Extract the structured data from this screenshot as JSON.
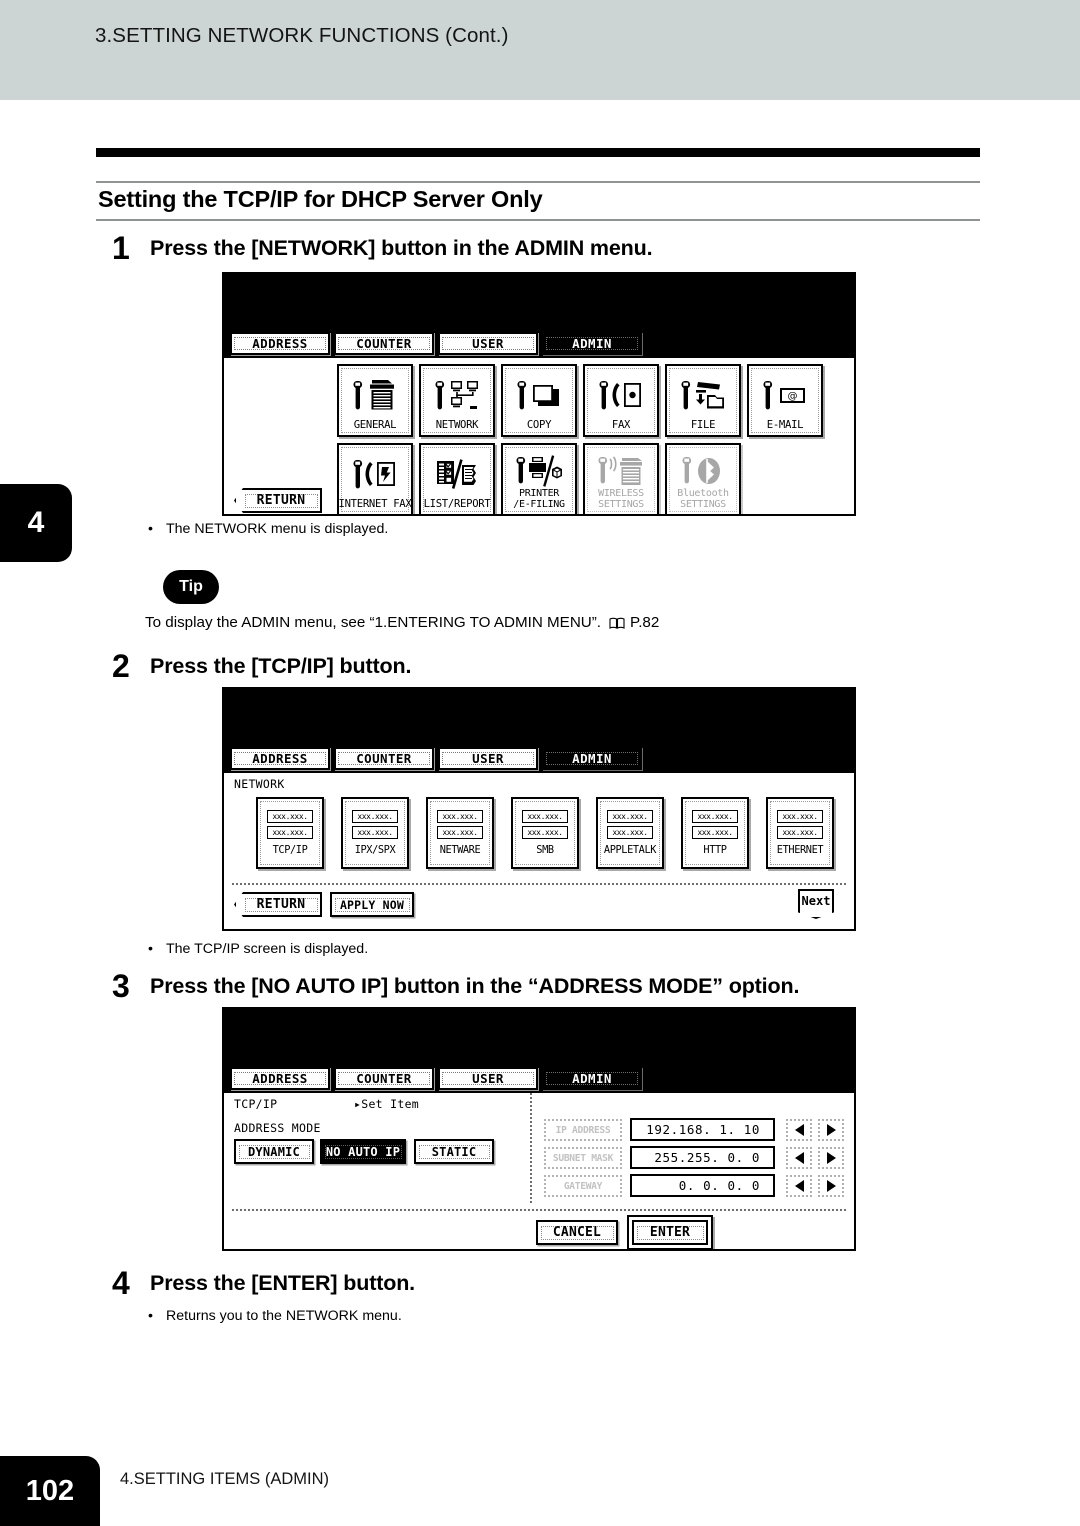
{
  "header": {
    "running_head": "3.SETTING NETWORK FUNCTIONS (Cont.)"
  },
  "chapter_tab": "4",
  "section": {
    "title": "Setting the TCP/IP for DHCP Server Only"
  },
  "steps": [
    {
      "number": "1",
      "text": "Press the [NETWORK] button in the ADMIN menu."
    },
    {
      "number": "2",
      "text": "Press the [TCP/IP] button."
    },
    {
      "number": "3",
      "text": "Press the [NO AUTO IP] button in the “ADDRESS MODE” option."
    },
    {
      "number": "4",
      "text": "Press the [ENTER] button."
    }
  ],
  "notes": {
    "step1": "The NETWORK menu is displayed.",
    "step2": "The TCP/IP screen is displayed.",
    "step4": "Returns you to the NETWORK menu."
  },
  "tip": {
    "badge": "Tip",
    "text_before": "To display the ADMIN menu, see “1.ENTERING TO ADMIN MENU”.",
    "page_ref": "P.82"
  },
  "screens": {
    "admin_menu": {
      "tabs": [
        {
          "label": "ADDRESS",
          "selected": false
        },
        {
          "label": "COUNTER",
          "selected": false
        },
        {
          "label": "USER",
          "selected": false
        },
        {
          "label": "ADMIN",
          "selected": true
        }
      ],
      "tiles_row1": [
        {
          "label": "GENERAL",
          "icon": "wrench-copier-icon",
          "disabled": false
        },
        {
          "label": "NETWORK",
          "icon": "wrench-network-icon",
          "disabled": false
        },
        {
          "label": "COPY",
          "icon": "wrench-copy-icon",
          "disabled": false
        },
        {
          "label": "FAX",
          "icon": "wrench-fax-icon",
          "disabled": false
        },
        {
          "label": "FILE",
          "icon": "wrench-file-icon",
          "disabled": false
        },
        {
          "label": "E-MAIL",
          "icon": "wrench-email-icon",
          "disabled": false
        }
      ],
      "tiles_row2": [
        {
          "label": "INTERNET FAX",
          "label2": "",
          "icon": "wrench-internetfax-icon",
          "disabled": false
        },
        {
          "label": "LIST/REPORT",
          "label2": "",
          "icon": "list-report-icon",
          "disabled": false
        },
        {
          "label": "PRINTER",
          "label2": "/E-FILING",
          "icon": "wrench-printer-icon",
          "disabled": false
        },
        {
          "label": "WIRELESS",
          "label2": "SETTINGS",
          "icon": "wrench-wireless-icon",
          "disabled": true
        },
        {
          "label": "Bluetooth",
          "label2": "SETTINGS",
          "icon": "wrench-bluetooth-icon",
          "disabled": true
        }
      ],
      "return_button": "RETURN"
    },
    "network_menu": {
      "tabs": [
        {
          "label": "ADDRESS",
          "selected": false
        },
        {
          "label": "COUNTER",
          "selected": false
        },
        {
          "label": "USER",
          "selected": false
        },
        {
          "label": "ADMIN",
          "selected": true
        }
      ],
      "caption": "NETWORK",
      "tiles": [
        {
          "label": "TCP/IP",
          "line1": "xxx.xxx.",
          "line2": "xxx.xxx."
        },
        {
          "label": "IPX/SPX",
          "line1": "xxx.xxx.",
          "line2": "xxx.xxx."
        },
        {
          "label": "NETWARE",
          "line1": "xxx.xxx.",
          "line2": "xxx.xxx."
        },
        {
          "label": "SMB",
          "line1": "xxx.xxx.",
          "line2": "xxx.xxx."
        },
        {
          "label": "APPLETALK",
          "line1": "xxx.xxx.",
          "line2": "xxx.xxx."
        },
        {
          "label": "HTTP",
          "line1": "xxx.xxx.",
          "line2": "xxx.xxx."
        },
        {
          "label": "ETHERNET",
          "line1": "xxx.xxx.",
          "line2": "xxx.xxx."
        }
      ],
      "return_button": "RETURN",
      "apply_button": "APPLY NOW",
      "next_button": "Next"
    },
    "tcpip_screen": {
      "tabs": [
        {
          "label": "ADDRESS",
          "selected": false
        },
        {
          "label": "COUNTER",
          "selected": false
        },
        {
          "label": "USER",
          "selected": false
        },
        {
          "label": "ADMIN",
          "selected": true
        }
      ],
      "caption": "TCP/IP",
      "set_item": "Set Item",
      "address_mode_label": "ADDRESS MODE",
      "address_mode_options": [
        {
          "label": "DYNAMIC",
          "selected": false
        },
        {
          "label": "NO AUTO IP",
          "selected": true
        },
        {
          "label": "STATIC",
          "selected": false
        }
      ],
      "fields": [
        {
          "label": "IP ADDRESS",
          "value": "192.168.  1. 10"
        },
        {
          "label": "SUBNET MASK",
          "value": "255.255.  0.  0"
        },
        {
          "label": "GATEWAY",
          "value": "0.  0.  0.  0"
        }
      ],
      "cancel_button": "CANCEL",
      "enter_button": "ENTER"
    }
  },
  "footer": {
    "page_number": "102",
    "chapter": "4.SETTING ITEMS (ADMIN)"
  },
  "colors": {
    "header_band": "#ccd5d3",
    "ink": "#000000",
    "rule": "#8d9492"
  }
}
